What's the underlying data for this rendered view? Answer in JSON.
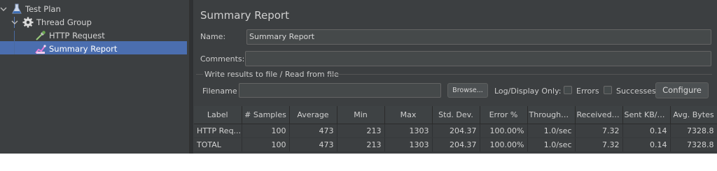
{
  "tree": {
    "items": [
      {
        "label": "Test Plan",
        "icon": "flask-icon"
      },
      {
        "label": "Thread Group",
        "icon": "gear-icon"
      },
      {
        "label": "HTTP Request",
        "icon": "pipette-icon"
      },
      {
        "label": "Summary Report",
        "icon": "chart-icon"
      }
    ]
  },
  "panel": {
    "title": "Summary Report",
    "name_label": "Name:",
    "name_value": "Summary Report",
    "comments_label": "Comments:",
    "comments_value": "",
    "group_title": "Write results to file / Read from file",
    "filename_label": "Filename",
    "filename_value": "",
    "browse_label": "Browse...",
    "log_display_label": "Log/Display Only:",
    "errors_label": "Errors",
    "successes_label": "Successes",
    "configure_label": "Configure"
  },
  "table": {
    "headers": [
      "Label",
      "# Samples",
      "Average",
      "Min",
      "Max",
      "Std. Dev.",
      "Error %",
      "Throughput",
      "Received ...",
      "Sent KB/sec",
      "Avg. Bytes"
    ],
    "rows": [
      [
        "HTTP Req...",
        "100",
        "473",
        "213",
        "1303",
        "204.37",
        "100.00%",
        "1.0/sec",
        "7.32",
        "0.14",
        "7328.8"
      ],
      [
        "TOTAL",
        "100",
        "473",
        "213",
        "1303",
        "204.37",
        "100.00%",
        "1.0/sec",
        "7.32",
        "0.14",
        "7328.8"
      ]
    ]
  },
  "colors": {
    "background": "#3c3f41",
    "selection": "#4b6eaf",
    "field": "#45494a"
  }
}
